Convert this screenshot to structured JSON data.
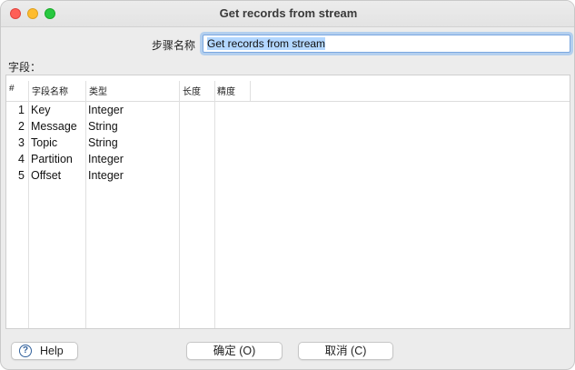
{
  "window": {
    "title": "Get records from stream"
  },
  "step": {
    "label": "步骤名称",
    "value": "Get records from stream"
  },
  "fields": {
    "label": "字段：",
    "columns": [
      "#",
      "字段名称",
      "类型",
      "长度",
      "精度"
    ],
    "rows": [
      {
        "num": "1",
        "name": "Key",
        "type": "Integer"
      },
      {
        "num": "2",
        "name": "Message",
        "type": "String"
      },
      {
        "num": "3",
        "name": "Topic",
        "type": "String"
      },
      {
        "num": "4",
        "name": "Partition",
        "type": "Integer"
      },
      {
        "num": "5",
        "name": "Offset",
        "type": "Integer"
      }
    ]
  },
  "buttons": {
    "help": "Help",
    "help_icon": "question-circle-icon",
    "ok": "确定 (O)",
    "cancel": "取消 (C)"
  },
  "colors": {
    "close": "#fe5f57",
    "minimize": "#febc2e",
    "maximize": "#28c840",
    "focus_ring": "#b3cfee",
    "selection": "#b3d7ff"
  }
}
